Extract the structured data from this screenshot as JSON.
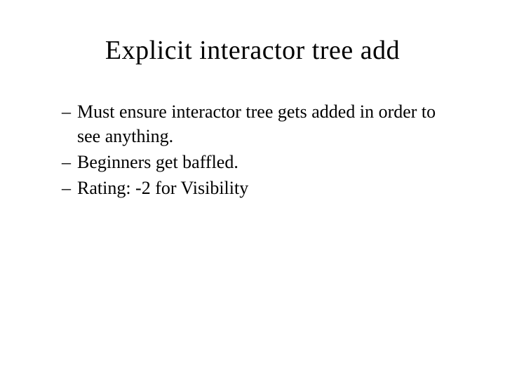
{
  "slide": {
    "title": "Explicit interactor tree add",
    "bullets": [
      "Must ensure interactor tree gets added in order to see anything.",
      "Beginners get baffled.",
      "Rating: -2 for Visibility"
    ]
  }
}
